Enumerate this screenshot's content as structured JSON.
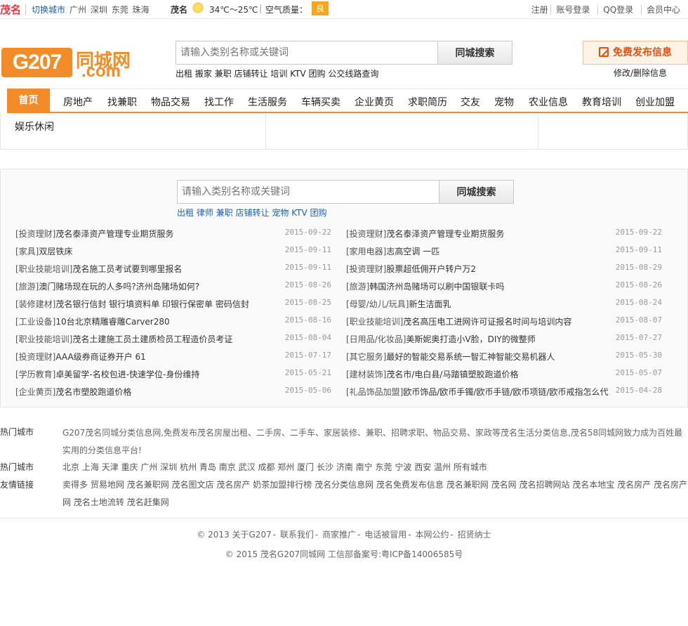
{
  "topbar": {
    "city": "茂名",
    "switch_city": "切换城市",
    "cities": [
      "广州",
      "深圳",
      "东莞",
      "珠海"
    ],
    "weather_city": "茂名",
    "weather_temp": "34℃～25℃",
    "air_label": "空气质量：",
    "air_value": "良",
    "links": [
      "注册",
      "账号登录",
      "QQ登录",
      "会员中心"
    ]
  },
  "header": {
    "logo_text": "G207",
    "logo_cn": "同城网",
    "logo_com": ".com",
    "search_placeholder": "请输入类别名称或关键词",
    "search_button": "同城搜索",
    "hot_links": [
      "出租",
      "搬家",
      "兼职",
      "店铺转让",
      "培训",
      "KTV",
      "团购",
      "公交线路查询"
    ],
    "publish_button": "免费发布信息",
    "edit_link": "修改/删除信息"
  },
  "nav": {
    "home": "首页",
    "items": [
      "房地产",
      "找兼职",
      "物品交易",
      "找工作",
      "生活服务",
      "车辆买卖",
      "企业黄页",
      "求职简历",
      "交友",
      "宠物",
      "农业信息",
      "教育培训",
      "创业加盟"
    ],
    "sub_item": "娱乐休闲"
  },
  "section2": {
    "search_placeholder": "请输入类别名称或关键词",
    "search_button": "同城搜索",
    "hot_links": [
      "出租",
      "律师",
      "兼职",
      "店铺转让",
      "宠物",
      "KTV",
      "团购"
    ]
  },
  "list_left": [
    {
      "cat": "[投资理财]",
      "title": "茂名泰泽资产管理专业期货服务",
      "date": "2015-09-22"
    },
    {
      "cat": "[家具]",
      "title": "双层铁床",
      "date": "2015-09-11"
    },
    {
      "cat": "[职业技能培训]",
      "title": "茂名施工员考试要到哪里报名",
      "date": "2015-09-11"
    },
    {
      "cat": "[旅游]",
      "title": "澳门赌场现在玩的人多吗?济州岛赌场如何?",
      "date": "2015-08-26"
    },
    {
      "cat": "[装修建材]",
      "title": "茂名银行信封 银行填资料单 印银行保密单 密码信封",
      "date": "2015-08-25"
    },
    {
      "cat": "[工业设备]",
      "title": "10台北京精雕睿雕Carver280",
      "date": "2015-08-16"
    },
    {
      "cat": "[职业技能培训]",
      "title": "茂名土建施工员土建质检员工程造价员考证",
      "date": "2015-08-04"
    },
    {
      "cat": "[投资理财]",
      "title": "AAA级券商证券开户 61",
      "date": "2015-07-17"
    },
    {
      "cat": "[学历教育]",
      "title": "卓美留学-名校包进-快速学位-身份维持",
      "date": "2015-05-21"
    },
    {
      "cat": "[企业黄页]",
      "title": "茂名市塑胶跑道价格",
      "date": "2015-05-06"
    }
  ],
  "list_right": [
    {
      "cat": "[投资理财]",
      "title": "茂名泰泽资产管理专业期货服务",
      "date": "2015-09-22"
    },
    {
      "cat": "[家用电器]",
      "title": "志高空调 一匹",
      "date": "2015-09-11"
    },
    {
      "cat": "[投资理财]",
      "title": "股票超低佣开户转户万2",
      "date": "2015-08-29"
    },
    {
      "cat": "[旅游]",
      "title": "韩国济州岛赌场可以刷中国银联卡吗",
      "date": "2015-08-26"
    },
    {
      "cat": "[母婴/幼儿/玩具]",
      "title": "新生洁面乳",
      "date": "2015-08-24"
    },
    {
      "cat": "[职业技能培训]",
      "title": "茂名高压电工进网许可证报名时间与培训内容",
      "date": "2015-08-07"
    },
    {
      "cat": "[日用品/化妆品]",
      "title": "美斯妮奥打造小V脸，DIY的微整师",
      "date": "2015-07-27"
    },
    {
      "cat": "[其它服务]",
      "title": "最好的智能交易系统一智汇神智能交易机器人",
      "date": "2015-05-30"
    },
    {
      "cat": "[建材装饰]",
      "title": "茂名市/电白县/马踏镇塑胶跑道价格",
      "date": "2015-05-07"
    },
    {
      "cat": "[礼品饰品加盟]",
      "title": "欧币饰品/欧币手镯/欧币手链/欧币项链/欧币戒指怎么代",
      "date": "2015-04-28"
    }
  ],
  "footer": {
    "intro_label": "热门城市",
    "intro_text": "G207茂名同城分类信息网,免费发布茂名房屋出租、二手房、二手车、家居装修、兼职、招聘求职、物品交易、家政等茂名生活分类信息,茂名58同城网致力成为百姓最实用的分类信息平台!",
    "hot_label": "热门城市",
    "hot_cities": [
      "北京",
      "上海",
      "天津",
      "重庆",
      "广州",
      "深圳",
      "杭州",
      "青岛",
      "南京",
      "武汉",
      "成都",
      "郑州",
      "厦门",
      "长沙",
      "济南",
      "南宁",
      "东莞",
      "宁波",
      "西安",
      "温州",
      "所有城市"
    ],
    "friend_label": "友情链接",
    "friend_links": [
      "卖得多",
      "贸易地网",
      "茂名兼职网",
      "茂名图文店",
      "茂名房产",
      "奶茶加盟排行榜",
      "茂名分类信息网",
      "茂名免费发布信息",
      "茂名兼职网",
      "茂名网",
      "茂名招聘网站",
      "茂名本地宝",
      "茂名房产",
      "茂名房产网",
      "茂名土地流转",
      "茂名赶集网"
    ],
    "bottom_links": [
      "© 2013 关于G207",
      "联系我们",
      "商家推广",
      "电话被冒用",
      "本网公约",
      "招贤纳士"
    ],
    "copyright": "© 2015 茂名G207同城网 工信部备案号:粤ICP备14006585号"
  },
  "colors": {
    "accent": "#f28c28",
    "link": "#1b5fb5",
    "city_red": "#e4393c",
    "publish": "#e4500b"
  }
}
